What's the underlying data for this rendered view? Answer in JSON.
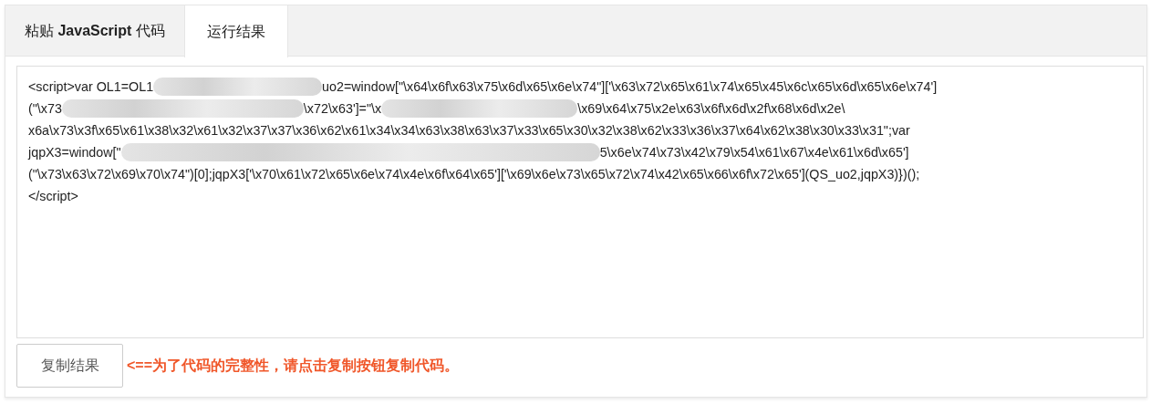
{
  "tabs": [
    {
      "label": "粘贴 **JavaScript** 代码",
      "selected": false
    },
    {
      "label": "运行结果",
      "selected": true
    }
  ],
  "code_lines": [
    [
      {
        "kind": "text",
        "text": "<script>var OL1=OL1"
      },
      {
        "kind": "blurred"
      },
      {
        "kind": "text",
        "text": "uo2=window[\"\\x64\\x6f\\x63\\x75\\x6d\\x65\\x6e\\x74\"]['\\x63\\x72\\x65\\x61\\x74\\x65\\x45\\x6c\\x65\\x6d\\x65\\x6e\\x74']"
      }
    ],
    [
      {
        "kind": "text",
        "text": "(\"\\x73"
      },
      {
        "kind": "blurred"
      },
      {
        "kind": "text",
        "text": "\\x72\\x63']=\"\\x"
      },
      {
        "kind": "blurred"
      },
      {
        "kind": "text",
        "text": "\\x69\\x64\\x75\\x2e\\x63\\x6f\\x6d\\x2f\\x68\\x6d\\x2e\\"
      }
    ],
    [
      {
        "kind": "text",
        "text": "x6a\\x73\\x3f\\x65\\x61\\x38\\x32\\x61\\x32\\x37\\x37\\x36\\x62\\x61\\x34\\x34\\x63\\x38\\x63\\x37\\x33\\x65\\x30\\x32\\x38\\x62\\x33\\x36\\x37\\x64\\x62\\x38\\x30\\x33\\x31\";var"
      }
    ],
    [
      {
        "kind": "text",
        "text": "jqpX3=window[\""
      },
      {
        "kind": "blurred"
      },
      {
        "kind": "text",
        "text": "5\\x6e\\x74\\x73\\x42\\x79\\x54\\x61\\x67\\x4e\\x61\\x6d\\x65']"
      }
    ],
    [
      {
        "kind": "text",
        "text": "(\"\\x73\\x63\\x72\\x69\\x70\\x74\")[0];jqpX3['\\x70\\x61\\x72\\x65\\x6e\\x74\\x4e\\x6f\\x64\\x65']['\\x69\\x6e\\x73\\x65\\x72\\x74\\x42\\x65\\x66\\x6f\\x72\\x65'](QS_uo2,jqpX3)})();"
      }
    ],
    [
      {
        "kind": "text",
        "text": "</script>"
      }
    ]
  ],
  "copy_button": "复制结果",
  "hint": "<==为了代码的完整性，请点击复制按钮复制代码。"
}
